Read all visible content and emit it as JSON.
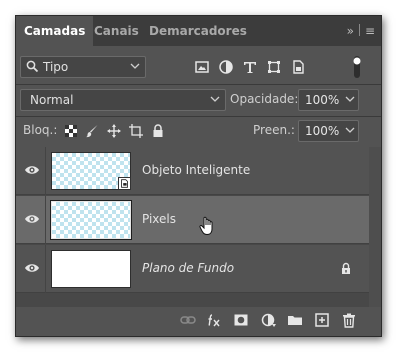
{
  "tabs": [
    {
      "label": "Camadas",
      "active": true
    },
    {
      "label": "Canais",
      "active": false
    },
    {
      "label": "Demarcadores",
      "active": false
    }
  ],
  "tab_menu": {
    "collapse": "»",
    "menu": "≡"
  },
  "filter": {
    "selected": "Tipo",
    "icon": "search-icon"
  },
  "blend": {
    "mode": "Normal"
  },
  "opacity": {
    "label": "Opacidade:",
    "value": "100%"
  },
  "lock": {
    "label": "Bloq.:"
  },
  "fill": {
    "label": "Preen.:",
    "value": "100%"
  },
  "layers": [
    {
      "name": "Objeto Inteligente",
      "italic": false,
      "selected": false,
      "thumb": "checker",
      "smart_object": true,
      "locked": false
    },
    {
      "name": "Pixels",
      "italic": false,
      "selected": true,
      "thumb": "checker",
      "smart_object": false,
      "locked": false
    },
    {
      "name": "Plano de Fundo",
      "italic": true,
      "selected": false,
      "thumb": "white",
      "smart_object": false,
      "locked": true
    }
  ],
  "colors": {
    "panel": "#535353",
    "tabbar": "#3c3c3c",
    "selected_layer": "#6a6a6a",
    "transparency_checker": "#bfe3ee"
  }
}
